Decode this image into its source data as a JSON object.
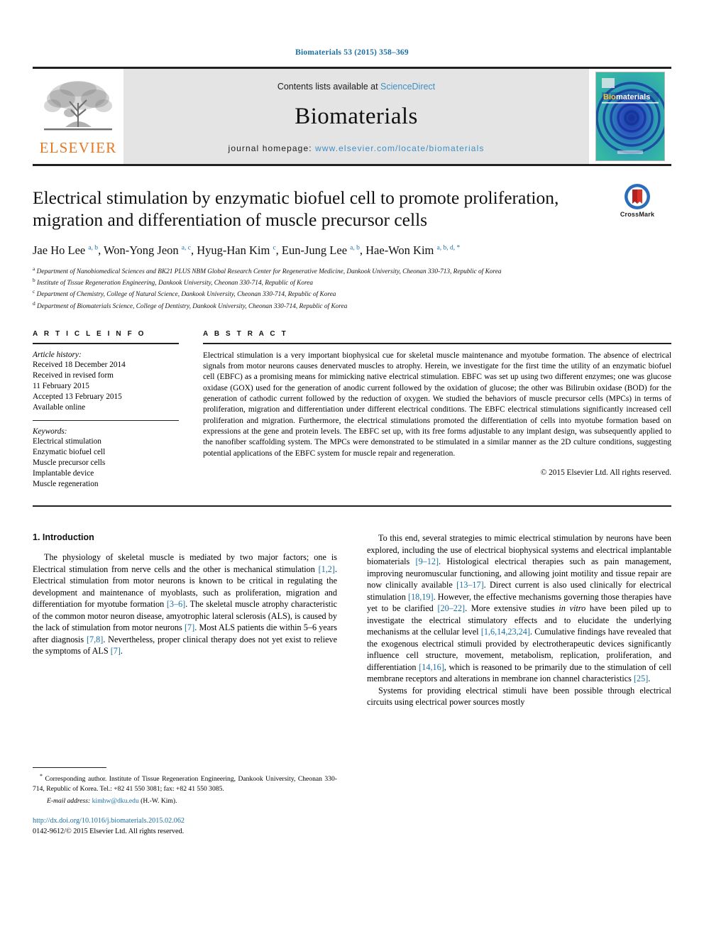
{
  "running_head": "Biomaterials 53 (2015) 358–369",
  "masthead": {
    "publisher_wordmark": "ELSEVIER",
    "contents_prefix": "Contents lists available at ",
    "contents_link": "ScienceDirect",
    "journal_name": "Biomaterials",
    "homepage_prefix": "journal homepage: ",
    "homepage_url": "www.elsevier.com/locate/biomaterials",
    "cover_title": "Biomaterials"
  },
  "article": {
    "title": "Electrical stimulation by enzymatic biofuel cell to promote proliferation, migration and differentiation of muscle precursor cells",
    "crossmark_label": "CrossMark",
    "authors_html": "Jae Ho Lee <sup>a, b</sup>, Won-Yong Jeon <sup>a, c</sup>, Hyug-Han Kim <sup>c</sup>, Eun-Jung Lee <sup>a, b</sup>, Hae-Won Kim <sup>a, b, d, *</sup>",
    "affiliations": [
      "Department of Nanobiomedical Sciences and BK21 PLUS NBM Global Research Center for Regenerative Medicine, Dankook University, Cheonan 330-713, Republic of Korea",
      "Institute of Tissue Regeneration Engineering, Dankook University, Cheonan 330-714, Republic of Korea",
      "Department of Chemistry, College of Natural Science, Dankook University, Cheonan 330-714, Republic of Korea",
      "Department of Biomaterials Science, College of Dentistry, Dankook University, Cheonan 330-714, Republic of Korea"
    ],
    "affiliation_markers": [
      "a",
      "b",
      "c",
      "d"
    ]
  },
  "info": {
    "heading": "A R T I C L E  I N F O",
    "history_label": "Article history:",
    "history": [
      "Received 18 December 2014",
      "Received in revised form",
      "11 February 2015",
      "Accepted 13 February 2015",
      "Available online"
    ],
    "keywords_label": "Keywords:",
    "keywords": [
      "Electrical stimulation",
      "Enzymatic biofuel cell",
      "Muscle precursor cells",
      "Implantable device",
      "Muscle regeneration"
    ]
  },
  "abstract": {
    "heading": "A B S T R A C T",
    "text": "Electrical stimulation is a very important biophysical cue for skeletal muscle maintenance and myotube formation. The absence of electrical signals from motor neurons causes denervated muscles to atrophy. Herein, we investigate for the first time the utility of an enzymatic biofuel cell (EBFC) as a promising means for mimicking native electrical stimulation. EBFC was set up using two different enzymes; one was glucose oxidase (GOX) used for the generation of anodic current followed by the oxidation of glucose; the other was Bilirubin oxidase (BOD) for the generation of cathodic current followed by the reduction of oxygen. We studied the behaviors of muscle precursor cells (MPCs) in terms of proliferation, migration and differentiation under different electrical conditions. The EBFC electrical stimulations significantly increased cell proliferation and migration. Furthermore, the electrical stimulations promoted the differentiation of cells into myotube formation based on expressions at the gene and protein levels. The EBFC set up, with its free forms adjustable to any implant design, was subsequently applied to the nanofiber scaffolding system. The MPCs were demonstrated to be stimulated in a similar manner as the 2D culture conditions, suggesting potential applications of the EBFC system for muscle repair and regeneration.",
    "copyright": "© 2015 Elsevier Ltd. All rights reserved."
  },
  "introduction": {
    "heading": "1. Introduction",
    "left_paragraph_html": "The physiology of skeletal muscle is mediated by two major factors; one is Electrical stimulation from nerve cells and the other is mechanical stimulation <span class=\"ref\">[1,2]</span>. Electrical stimulation from motor neurons is known to be critical in regulating the development and maintenance of myoblasts, such as proliferation, migration and differentiation for myotube formation <span class=\"ref\">[3&#8211;6]</span>. The skeletal muscle atrophy characteristic of the common motor neuron disease, amyotrophic lateral sclerosis (ALS), is caused by the lack of stimulation from motor neurons <span class=\"ref\">[7]</span>. Most ALS patients die within 5&#8211;6 years after diagnosis <span class=\"ref\">[7,8]</span>. Nevertheless, proper clinical therapy does not yet exist to relieve the symptoms of ALS <span class=\"ref\">[7]</span>.",
    "right_paragraph_1_html": "To this end, several strategies to mimic electrical stimulation by neurons have been explored, including the use of electrical biophysical systems and electrical implantable biomaterials <span class=\"ref\">[9&#8211;12]</span>. Histological electrical therapies such as pain management, improving neuromuscular functioning, and allowing joint motility and tissue repair are now clinically available <span class=\"ref\">[13&#8211;17]</span>. Direct current is also used clinically for electrical stimulation <span class=\"ref\">[18,19]</span>. However, the effective mechanisms governing those therapies have yet to be clarified <span class=\"ref\">[20&#8211;22]</span>. More extensive studies <i>in vitro</i> have been piled up to investigate the electrical stimulatory effects and to elucidate the underlying mechanisms at the cellular level <span class=\"ref\">[1,6,14,23,24]</span>. Cumulative findings have revealed that the exogenous electrical stimuli provided by electrotherapeutic devices significantly influence cell structure, movement, metabolism, replication, proliferation, and differentiation <span class=\"ref\">[14,16]</span>, which is reasoned to be primarily due to the stimulation of cell membrane receptors and alterations in membrane ion channel characteristics <span class=\"ref\">[25]</span>.",
    "right_paragraph_2_html": "Systems for providing electrical stimuli have been possible through electrical circuits using electrical power sources mostly"
  },
  "footnote": {
    "corresponding_html": "<sup>*</sup> Corresponding author. Institute of Tissue Regeneration Engineering, Dankook University, Cheonan 330-714, Republic of Korea. Tel.: +82 41 550 3081; fax: +82 41 550 3085.",
    "email_label": "E-mail address:",
    "email": "kimhw@dku.edu",
    "email_suffix": "(H.-W. Kim).",
    "doi": "http://dx.doi.org/10.1016/j.biomaterials.2015.02.062",
    "issn_line": "0142-9612/© 2015 Elsevier Ltd. All rights reserved."
  },
  "colors": {
    "link_blue": "#1a6fa3",
    "science_direct_blue": "#3d8fc4",
    "elsevier_orange": "#e87722",
    "masthead_gray": "#e4e4e4",
    "cover_teal": "#2aa79b",
    "cover_blue": "#1f3f9e"
  }
}
